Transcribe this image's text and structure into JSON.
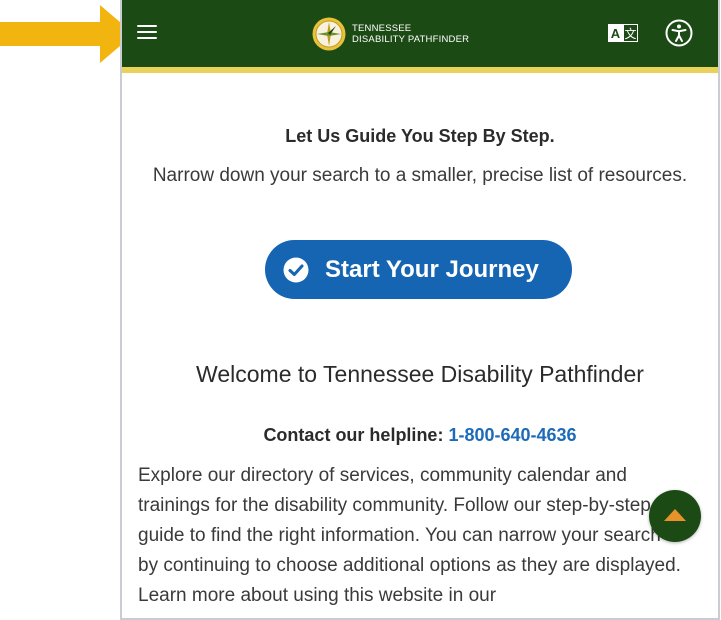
{
  "header": {
    "logo_line1": "TENNESSEE",
    "logo_line2": "DISABILITY PATHFINDER",
    "menu_icon": "hamburger-menu-icon",
    "translate_icon": "translate-icon",
    "accessibility_icon": "accessibility-icon",
    "bg_color": "#1c4a15",
    "accent_color": "#e8d25a"
  },
  "guide": {
    "title": "Let Us Guide You Step By Step.",
    "subtitle": "Narrow down your search to a smaller, precise list of resources.",
    "cta_label": "Start Your Journey",
    "cta_icon": "check-circle-icon",
    "cta_color": "#1565b3"
  },
  "welcome": {
    "title": "Welcome to Tennessee Disability Pathfinder",
    "helpline_label": "Contact our helpline:",
    "helpline_number": "1-800-640-4636",
    "body": "Explore our directory of services, community calendar and trainings for the disability community. Follow our step-by-step guide to find the right information. You can narrow your search by continuing to choose additional options as they are displayed. Learn more about using this website in our"
  },
  "scroll_top_icon": "arrow-up-icon",
  "annotation": {
    "arrow_icon": "pointer-arrow-icon",
    "arrow_color": "#f2b50f"
  }
}
